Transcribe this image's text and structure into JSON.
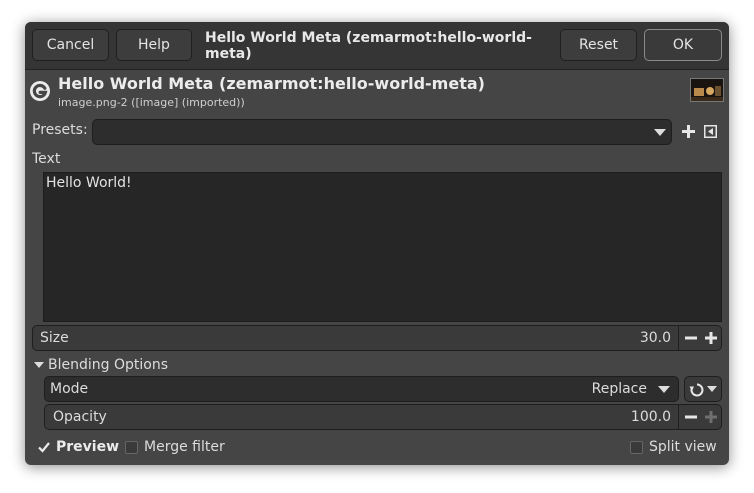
{
  "header": {
    "cancel_label": "Cancel",
    "help_label": "Help",
    "title": "Hello World Meta (zemarmot:hello-world-meta)",
    "reset_label": "Reset",
    "ok_label": "OK"
  },
  "filter": {
    "title": "Hello World Meta (zemarmot:hello-world-meta)",
    "subtitle": "image.png-2 ([image] (imported))",
    "logo_icon": "gimp-g-icon",
    "thumbnail_icon": "image-thumbnail"
  },
  "presets": {
    "label": "Presets:",
    "value": "",
    "add_icon": "plus-icon",
    "menu_icon": "menu-arrow-icon"
  },
  "text": {
    "label": "Text",
    "value": "Hello World!"
  },
  "size": {
    "label": "Size",
    "value": "30.0"
  },
  "blending": {
    "label": "Blending Options",
    "mode_label": "Mode",
    "mode_value": "Replace",
    "opacity_label": "Opacity",
    "opacity_value": "100.0",
    "opacity_fraction": 1.0
  },
  "footer": {
    "preview_label": "Preview",
    "preview_checked": true,
    "merge_label": "Merge filter",
    "merge_checked": false,
    "split_label": "Split view",
    "split_checked": false
  },
  "colors": {
    "dialog_bg": "#454545",
    "headerbar_bg": "#353535",
    "field_bg": "#2d2d2d",
    "text": "#dcdcdc"
  }
}
